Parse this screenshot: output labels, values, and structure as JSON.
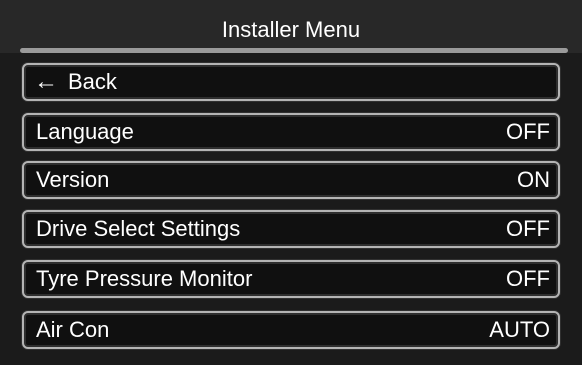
{
  "header": {
    "title": "Installer Menu"
  },
  "back": {
    "icon": "left-arrow-icon",
    "label": "Back"
  },
  "menu_items": [
    {
      "label": "Language",
      "value": "OFF"
    },
    {
      "label": "Version",
      "value": "ON"
    },
    {
      "label": "Drive Select Settings",
      "value": "OFF"
    },
    {
      "label": "Tyre Pressure Monitor",
      "value": "OFF"
    },
    {
      "label": "Air Con",
      "value": "AUTO"
    }
  ],
  "colors": {
    "background": "#000000",
    "panel": "#1b1b1b",
    "row_border": "#b4b4b4",
    "text": "#ffffff"
  }
}
